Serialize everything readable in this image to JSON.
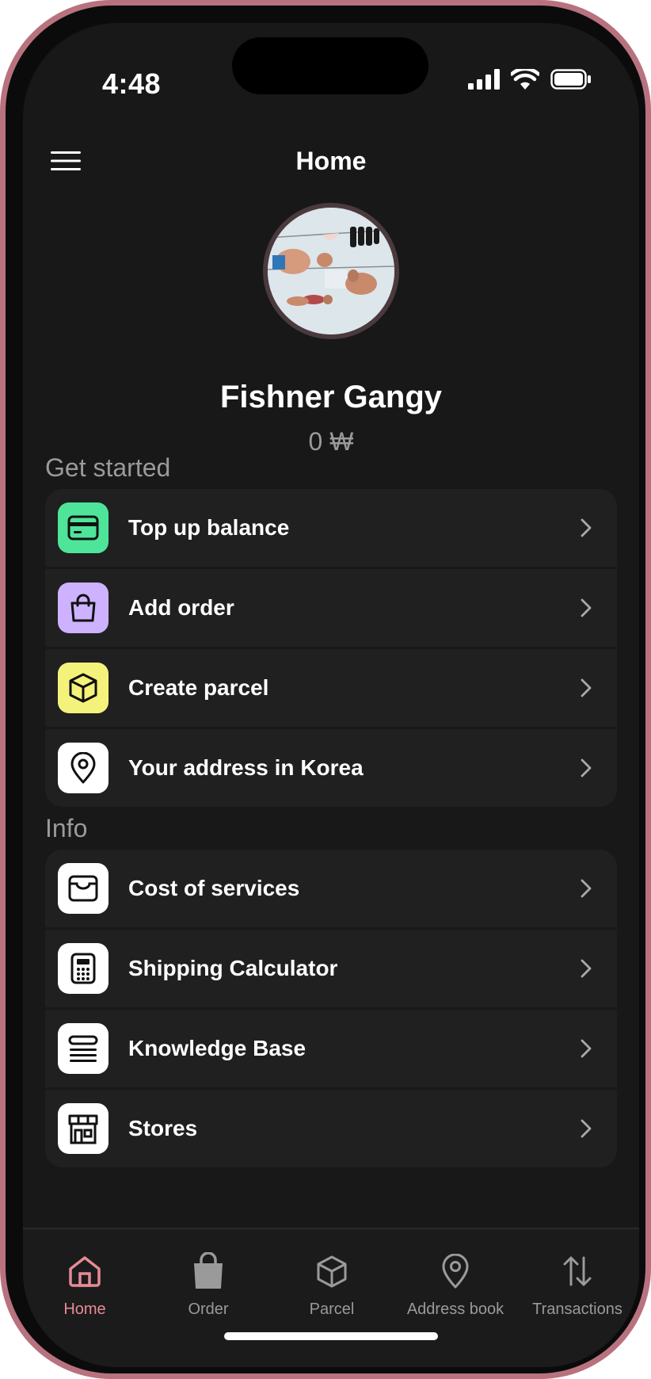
{
  "status_bar": {
    "time": "4:48"
  },
  "header": {
    "title": "Home"
  },
  "profile": {
    "name": "Fishner Gangy",
    "balance": "0 ₩"
  },
  "get_started": {
    "title": "Get started",
    "items": [
      {
        "label": "Top up balance",
        "icon": "card-icon",
        "color": "#4ee59a"
      },
      {
        "label": "Add order",
        "icon": "shopping-bag-icon",
        "color": "#cdb2ff"
      },
      {
        "label": "Create parcel",
        "icon": "box-icon",
        "color": "#f4f27a"
      },
      {
        "label": "Your address in Korea",
        "icon": "location-pin-icon",
        "color": "#ffffff"
      }
    ]
  },
  "info": {
    "title": "Info",
    "items": [
      {
        "label": "Cost of services",
        "icon": "inbox-icon",
        "color": "#ffffff"
      },
      {
        "label": "Shipping Calculator",
        "icon": "calculator-icon",
        "color": "#ffffff"
      },
      {
        "label": "Knowledge Base",
        "icon": "list-icon",
        "color": "#ffffff"
      },
      {
        "label": "Stores",
        "icon": "store-icon",
        "color": "#ffffff"
      }
    ]
  },
  "tabs": [
    {
      "label": "Home",
      "icon": "home-icon",
      "active": true
    },
    {
      "label": "Order",
      "icon": "bag-icon",
      "active": false
    },
    {
      "label": "Parcel",
      "icon": "box-icon",
      "active": false
    },
    {
      "label": "Address book",
      "icon": "location-pin-icon",
      "active": false
    },
    {
      "label": "Transactions",
      "icon": "arrows-icon",
      "active": false
    }
  ],
  "colors": {
    "accent": "#e88a96",
    "background": "#181818",
    "card": "#202020"
  }
}
